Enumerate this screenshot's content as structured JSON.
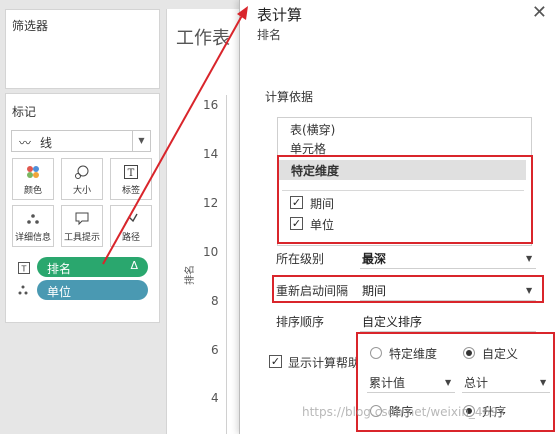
{
  "filters_pane": {
    "title": "筛选器"
  },
  "marks_pane": {
    "title": "标记",
    "mark_type": "线",
    "buttons": [
      {
        "label": "颜色",
        "icon": "color-dots-icon"
      },
      {
        "label": "大小",
        "icon": "size-icon"
      },
      {
        "label": "标签",
        "icon": "label-T-icon"
      },
      {
        "label": "详细信息",
        "icon": "detail-dots-icon"
      },
      {
        "label": "工具提示",
        "icon": "tooltip-icon"
      },
      {
        "label": "路径",
        "icon": "path-icon"
      }
    ],
    "pills": [
      {
        "label": "排名",
        "badge": "Δ",
        "color": "#2aa76e"
      },
      {
        "label": "单位",
        "color": "#4a99b2"
      }
    ]
  },
  "worksheet": {
    "title": "工作表",
    "y_label": "排名",
    "y_ticks": [
      "16",
      "14",
      "12",
      "10",
      "8",
      "6",
      "4"
    ]
  },
  "dialog": {
    "title": "表计算",
    "subtitle": "排名",
    "compute_using_label": "计算依据",
    "compute_options": [
      "表(横穿)",
      "单元格",
      "特定维度"
    ],
    "selected_option": "特定维度",
    "dimensions": [
      {
        "label": "期间",
        "checked": true
      },
      {
        "label": "单位",
        "checked": true
      }
    ],
    "level": {
      "label": "所在级别",
      "value": "最深"
    },
    "restart": {
      "label": "重新启动间隔",
      "value": "期间"
    },
    "sort": {
      "label": "排序顺序",
      "value": "自定义排序"
    },
    "show_help": {
      "label": "显示计算帮助",
      "checked": true
    },
    "sort_panel": {
      "radio1": {
        "label": "特定维度",
        "selected": false
      },
      "radio2": {
        "label": "自定义",
        "selected": true
      },
      "field": "累计值",
      "aggregation": "总计",
      "order1": {
        "label": "降序",
        "selected": false
      },
      "order2": {
        "label": "升序",
        "selected": true
      }
    }
  },
  "watermark": "https://blog.csdn.net/weixin_4697",
  "colors": {
    "highlight_red": "#d9252b",
    "green_pill": "#2aa76e",
    "blue_pill": "#4a99b2"
  }
}
